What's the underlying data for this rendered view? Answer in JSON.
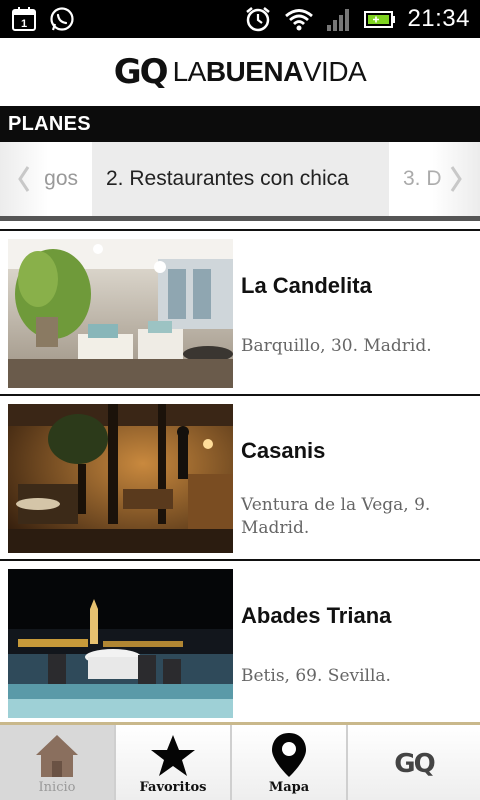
{
  "status_bar": {
    "time": "21:34",
    "calendar_day": "1",
    "icons": [
      "calendar-icon",
      "whatsapp-icon",
      "alarm-icon",
      "wifi-icon",
      "signal-icon",
      "battery-icon"
    ]
  },
  "app": {
    "logo_gq": "GQ",
    "logo_la": "LA",
    "logo_buena": "BUENA",
    "logo_vida": "VIDA"
  },
  "section": {
    "title": "PLANES"
  },
  "carousel": {
    "prev_label": "gos",
    "active_label": "2. Restaurantes con chica",
    "next_label": "3. D"
  },
  "items": [
    {
      "name": "La Candelita",
      "address": "Barquillo, 30. Madrid."
    },
    {
      "name": "Casanis",
      "address": "Ventura de la Vega, 9. Madrid."
    },
    {
      "name": "Abades Triana",
      "address": "Betis, 69. Sevilla."
    }
  ],
  "bottom_nav": {
    "inicio": "Inicio",
    "favoritos": "Favoritos",
    "mapa": "Mapa",
    "gq": "GQ"
  },
  "colors": {
    "status_bar": "#000000",
    "section_bar": "#0c0c0c",
    "active_tab": "#ececec",
    "nav_accent": "#c9b88b",
    "inicio_icon": "#8a6f5e"
  }
}
